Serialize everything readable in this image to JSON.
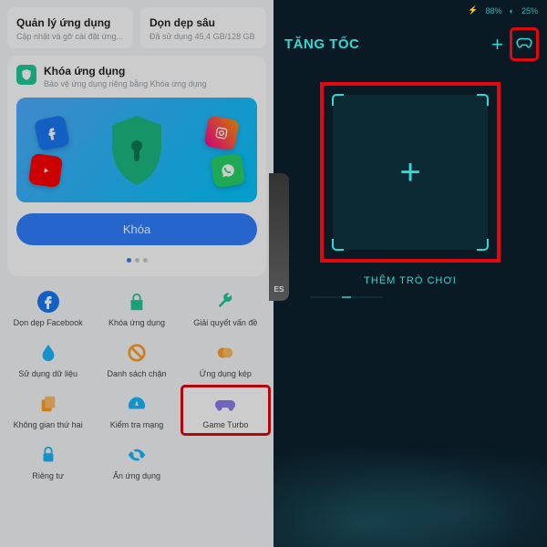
{
  "left": {
    "cards": [
      {
        "title": "Quản lý ứng dụng",
        "sub": "Cập nhật và gỡ cài đặt ứng..."
      },
      {
        "title": "Dọn dẹp sâu",
        "sub": "Đã sử dụng 45,4 GB/128 GB"
      }
    ],
    "lock": {
      "title": "Khóa ứng dụng",
      "sub": "Bảo vệ ứng dụng riêng bằng Khóa ứng dụng",
      "button": "Khóa"
    },
    "tools": [
      {
        "label": "Dọn dẹp Facebook"
      },
      {
        "label": "Khóa ứng dụng"
      },
      {
        "label": "Giải quyết vấn đề"
      },
      {
        "label": "Sử dụng dữ liệu"
      },
      {
        "label": "Danh sách chặn"
      },
      {
        "label": "Ứng dụng kép"
      },
      {
        "label": "Không gian thứ hai"
      },
      {
        "label": "Kiểm tra mạng"
      },
      {
        "label": "Game Turbo"
      },
      {
        "label": "Riêng tư"
      },
      {
        "label": "Ẩn ứng dụng"
      }
    ]
  },
  "right": {
    "status": {
      "battery": "88%",
      "memory": "25%"
    },
    "title": "TĂNG TỐC",
    "addGame": "THÊM TRÒ CHƠI",
    "pubg": "ES"
  }
}
